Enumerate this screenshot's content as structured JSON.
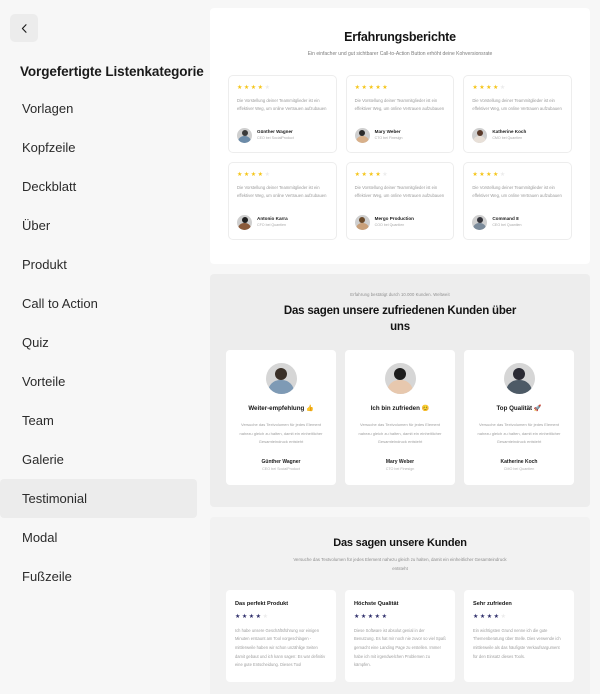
{
  "sidebar": {
    "back_icon": "chevron-left-icon",
    "title": "Vorgefertigte Listenkategorie",
    "items": [
      {
        "label": "Vorlagen",
        "active": false
      },
      {
        "label": "Kopfzeile",
        "active": false
      },
      {
        "label": "Deckblatt",
        "active": false
      },
      {
        "label": "Über",
        "active": false
      },
      {
        "label": "Produkt",
        "active": false
      },
      {
        "label": "Call to Action",
        "active": false
      },
      {
        "label": "Quiz",
        "active": false
      },
      {
        "label": "Vorteile",
        "active": false
      },
      {
        "label": "Team",
        "active": false
      },
      {
        "label": "Galerie",
        "active": false
      },
      {
        "label": "Testimonial",
        "active": true
      },
      {
        "label": "Modal",
        "active": false
      },
      {
        "label": "Fußzeile",
        "active": false
      }
    ]
  },
  "colors": {
    "star_gold": "#f5c518",
    "star_navy": "#2f2f6b",
    "sidebar_bg": "#f7f7f7",
    "active_bg": "#ececec",
    "section2_bg": "#ededed",
    "section3_bg": "#f2f2f2"
  },
  "sections": [
    {
      "id": "erfahrungsberichte",
      "title": "Erfahrungsberichte",
      "subtitle": "Ein einfacher und gut sichtbarer Call-to-Action Button erhöht deine Kohversionsrate",
      "cards": [
        {
          "rating": 4,
          "body": "Die Vorstellung deiner Teammitglieder ist ein effektiver Weg, um online Vertrauen aufzubauen",
          "name": "Günther Wagner",
          "role": "CEO bei SocialProduct",
          "hair": "#3a3a3a",
          "shirt": "#6c8ba8"
        },
        {
          "rating": 5,
          "body": "Die Vorstellung deiner Teammitglieder ist ein effektiver Weg, um online Vertrauen aufzubauen",
          "name": "Mary Weber",
          "role": "CTO bei Finesign",
          "hair": "#2b2b2b",
          "shirt": "#d8b08a"
        },
        {
          "rating": 4,
          "body": "Die Vorstellung deiner Teammitglieder ist ein effektiver Weg, um online Vertrauen aufzubauen",
          "name": "Katherine Koch",
          "role": "CMO bei Quantien",
          "hair": "#5a3a2a",
          "shirt": "#e8e0d8"
        },
        {
          "rating": 4,
          "body": "Die Vorstellung deiner Teammitglieder ist ein effektiver Weg, um online Vertrauen aufzubauen",
          "name": "Antonio Karra",
          "role": "CFO bei Quantien",
          "hair": "#1f1f1f",
          "shirt": "#8a5a3a"
        },
        {
          "rating": 4,
          "body": "Die Vorstellung deiner Teammitglieder ist ein effektiver Weg, um online Vertrauen aufzubauen",
          "name": "Mergo Production",
          "role": "COO bei Quantien",
          "hair": "#6b4a2a",
          "shirt": "#c9a07a"
        },
        {
          "rating": 4,
          "body": "Die Vorstellung deiner Teammitglieder ist ein effektiver Weg, um online Vertrauen aufzubauen",
          "name": "Command 8",
          "role": "CEO bei Quantien",
          "hair": "#33333a",
          "shirt": "#7a8a9a"
        }
      ]
    },
    {
      "id": "zufriedene-kunden",
      "eyebrow": "Erfahrung bestätigt durch 10.000 Kunden. Weltweit",
      "title": "Das sagen unsere zufriedenen Kunden über uns",
      "cards": [
        {
          "heading": "Weiter-empfehlung 👍",
          "body": "Versuche das Textvolumen für jedes Element nahezu gleich zu halten, damit ein einheitlicher Gesamteindruck entsteht",
          "name": "Günther Wagner",
          "role": "CEO bei SocialProduct",
          "hair": "#3a3028",
          "shirt": "#7e9ab5"
        },
        {
          "heading": "Ich bin zufrieden 😊",
          "body": "Versuche das Textvolumen für jedes Element nahezu gleich zu halten, damit ein einheitlicher Gesamteindruck entsteht",
          "name": "Mary Weber",
          "role": "CTO bei Finesign",
          "hair": "#1d1d1d",
          "shirt": "#e7c8ae"
        },
        {
          "heading": "Top Qualität 🚀",
          "body": "Versuche das Textvolumen für jedes Element nahezu gleich zu halten, damit ein einheitlicher Gesamteindruck entsteht",
          "name": "Katherine Koch",
          "role": "CMO bei Quantien",
          "hair": "#2a2a33",
          "shirt": "#4d5a66"
        }
      ]
    },
    {
      "id": "das-sagen-unsere-kunden",
      "title": "Das sagen unsere Kunden",
      "subtitle": "Versuche das Textvolumen für jedes Element nahezu gleich zu halten, damit ein einheitlicher Gesamteindruck entsteht",
      "cards": [
        {
          "heading": "Das perfekt Produkt",
          "rating": 4,
          "body": "Ich habe unsere Geschäftsführung vor einigen Minuten erstaunt am Tool vorgeschlagen - mittlerweile haben wir schon unzählige Seiten damit gebaut und ich kann sagen: Es war definitiv eine gute Entscheidung. Dieses Tool"
        },
        {
          "heading": "Höchste Qualität",
          "rating": 5,
          "body": "Diese Software ist absolut genial in der Benutzung. Es hat mir noch nie zuvor so viel Spaß gemacht eine Landing Page zu erstellen. Immer habe ich mit irgendwelchen Problemen zu kämpfen."
        },
        {
          "heading": "Sehr zufrieden",
          "rating": 4,
          "body": "Ein wichtigsten Grund nenne ich die gute Themenberatung über Stelle. Dies verwende ich mittlerweile als das häufigste Verkaufsargument für den Einsatz dieses Tools."
        }
      ]
    }
  ]
}
